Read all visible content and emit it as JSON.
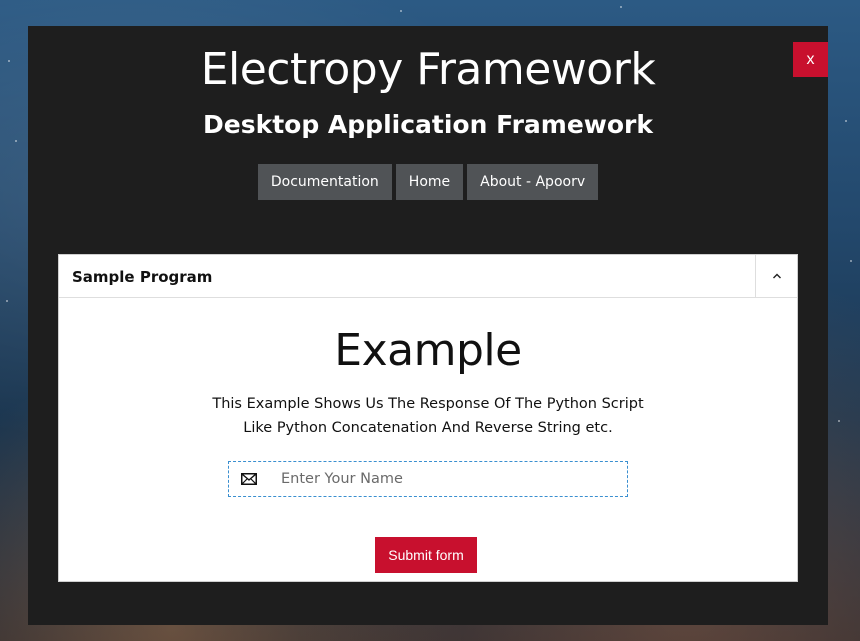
{
  "window": {
    "close_label": "x",
    "title": "Electropy Framework",
    "subtitle": "Desktop Application Framework"
  },
  "nav": {
    "items": [
      {
        "label": "Documentation"
      },
      {
        "label": "Home"
      },
      {
        "label": "About - Apoorv"
      }
    ]
  },
  "panel": {
    "title": "Sample Program",
    "collapse_icon": "chevron-up-icon",
    "heading": "Example",
    "description_line1": "This Example Shows Us The Response Of The Python Script",
    "description_line2": "Like Python Concatenation And Reverse String etc.",
    "input": {
      "icon": "envelope-icon",
      "value": "",
      "placeholder": "Enter Your Name"
    },
    "submit_label": "Submit form"
  },
  "colors": {
    "accent": "#c8102e",
    "window_bg": "#1e1e1e",
    "nav_button_bg": "#505356",
    "input_border": "#3a8fd0"
  }
}
